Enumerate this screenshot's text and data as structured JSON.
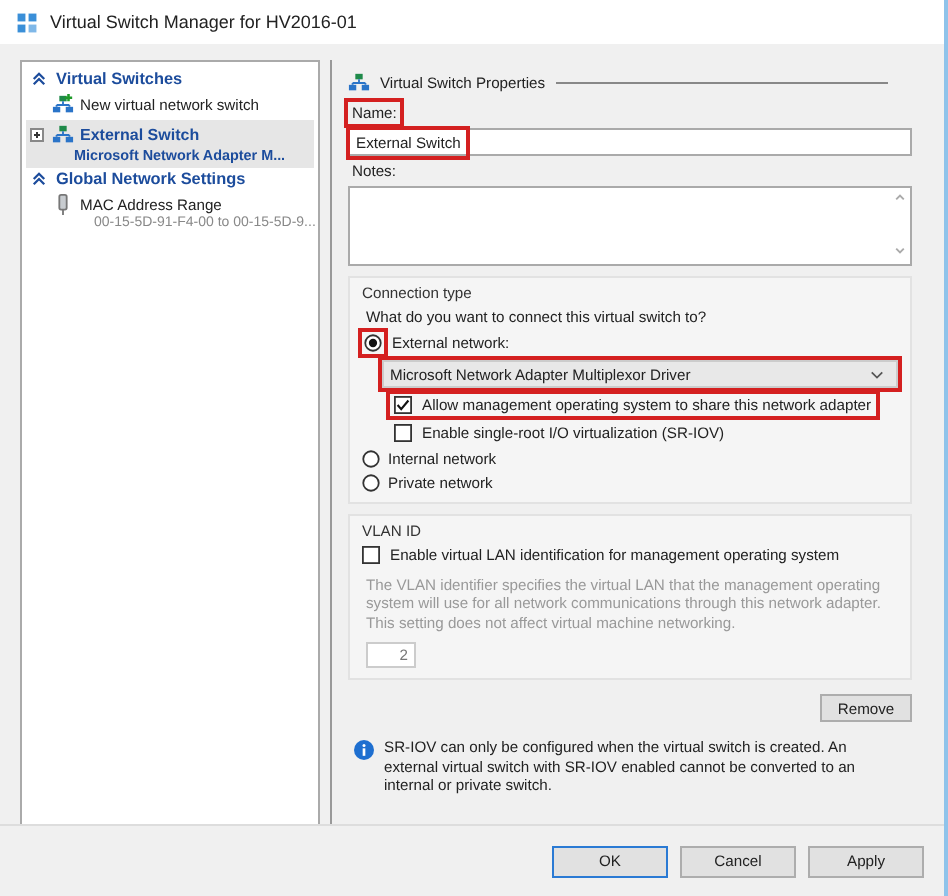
{
  "window": {
    "title": "Virtual Switch Manager for HV2016-01"
  },
  "sidebar": {
    "sections": [
      {
        "title": "Virtual Switches",
        "items": [
          {
            "kind": "new",
            "label": "New virtual network switch",
            "selected": false
          },
          {
            "kind": "switch",
            "label": "External Switch",
            "sublabel": "Microsoft Network Adapter M...",
            "selected": true,
            "expanded": false
          }
        ]
      },
      {
        "title": "Global Network Settings",
        "items": [
          {
            "kind": "mac",
            "label": "MAC Address Range",
            "sublabel": "00-15-5D-91-F4-00 to 00-15-5D-9...",
            "selected": false
          }
        ]
      }
    ]
  },
  "properties": {
    "title": "Virtual Switch Properties",
    "name": {
      "label": "Name:",
      "value": "External Switch",
      "highlighted": true
    },
    "notes": {
      "label": "Notes:"
    },
    "connection": {
      "title": "Connection type",
      "question": "What do you want to connect this virtual switch to?",
      "options": [
        {
          "label": "External network:",
          "selected": true,
          "highlighted": true
        },
        {
          "label": "Internal network",
          "selected": false,
          "highlighted": false
        },
        {
          "label": "Private network",
          "selected": false,
          "highlighted": false
        }
      ],
      "adapter": {
        "value": "Microsoft Network Adapter Multiplexor Driver",
        "highlighted": true
      },
      "checks": [
        {
          "label": "Allow management operating system to share this network adapter",
          "checked": true,
          "highlighted": true
        },
        {
          "label": "Enable single-root I/O virtualization (SR-IOV)",
          "checked": false,
          "highlighted": false
        }
      ]
    },
    "vlan": {
      "title": "VLAN ID",
      "check": {
        "label": "Enable virtual LAN identification for management operating system",
        "checked": false
      },
      "description": "The VLAN identifier specifies the virtual LAN that the management operating system will use for all network communications through this network adapter. This setting does not affect virtual machine networking.",
      "value": "2"
    },
    "remove": "Remove",
    "info": "SR-IOV can only be configured when the virtual switch is created. An external virtual switch with SR-IOV enabled cannot be converted to an internal or private switch."
  },
  "buttons": [
    {
      "label": "OK",
      "default": true
    },
    {
      "label": "Cancel",
      "default": false
    },
    {
      "label": "Apply",
      "default": false
    }
  ]
}
